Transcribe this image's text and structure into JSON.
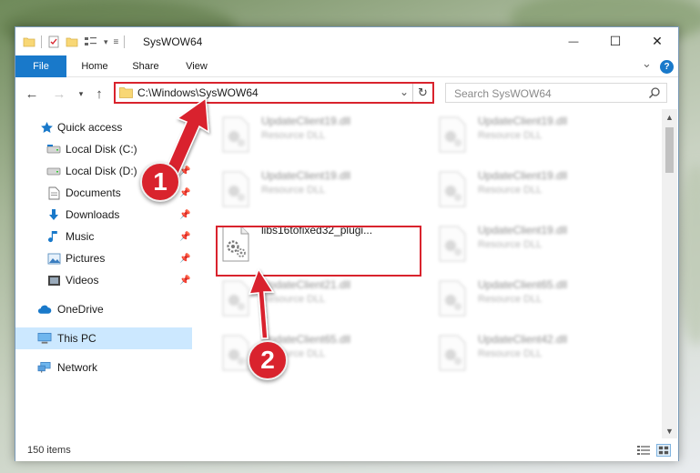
{
  "window": {
    "title": "SysWOW64",
    "minimize_glyph": "—",
    "maximize_glyph": "☐",
    "close_glyph": "✕"
  },
  "ribbon": {
    "tabs": [
      {
        "label": "File"
      },
      {
        "label": "Home"
      },
      {
        "label": "Share"
      },
      {
        "label": "View"
      }
    ],
    "collapse_glyph": "⌄",
    "help_glyph": "?"
  },
  "address_bar": {
    "path": "C:\\Windows\\SysWOW64",
    "dropdown_glyph": "⌄",
    "refresh_glyph": "↻"
  },
  "search": {
    "placeholder": "Search SysWOW64"
  },
  "nav_pane": {
    "items": [
      {
        "label": "Quick access",
        "icon": "star-icon",
        "pinned": false
      },
      {
        "label": "Local Disk (C:)",
        "icon": "drive-icon",
        "pinned": true
      },
      {
        "label": "Local Disk (D:)",
        "icon": "drive-icon",
        "pinned": true
      },
      {
        "label": "Documents",
        "icon": "documents-icon",
        "pinned": true
      },
      {
        "label": "Downloads",
        "icon": "download-icon",
        "pinned": true
      },
      {
        "label": "Music",
        "icon": "music-icon",
        "pinned": true
      },
      {
        "label": "Pictures",
        "icon": "pictures-icon",
        "pinned": true
      },
      {
        "label": "Videos",
        "icon": "videos-icon",
        "pinned": true
      },
      {
        "label": "OneDrive",
        "icon": "cloud-icon",
        "pinned": false
      },
      {
        "label": "This PC",
        "icon": "computer-icon",
        "pinned": false
      },
      {
        "label": "Network",
        "icon": "network-icon",
        "pinned": false
      }
    ]
  },
  "files": [
    {
      "name": "UpdateClient19.dll",
      "type": "Resource DLL"
    },
    {
      "name": "UpdateClient19.dll",
      "type": "Resource DLL"
    },
    {
      "name": "UpdateClient19.dll",
      "type": "Resource DLL"
    },
    {
      "name": "UpdateClient19.dll",
      "type": "Resource DLL"
    },
    {
      "name": "libs16tofixed32_plugi...",
      "type": ""
    },
    {
      "name": "UpdateClient19.dll",
      "type": "Resource DLL"
    },
    {
      "name": "UpdateClient21.dll",
      "type": "Resource DLL"
    },
    {
      "name": "UpdateClient65.dll",
      "type": "Resource DLL"
    },
    {
      "name": "UpdateClient65.dll",
      "type": "Resource DLL"
    },
    {
      "name": "UpdateClient42.dll",
      "type": "Resource DLL"
    }
  ],
  "status": {
    "item_count": "150 items"
  },
  "callouts": {
    "step1": "1",
    "step2": "2"
  },
  "colors": {
    "accent": "#1979ca",
    "highlight": "#d9232d",
    "selected": "#cce8ff"
  }
}
